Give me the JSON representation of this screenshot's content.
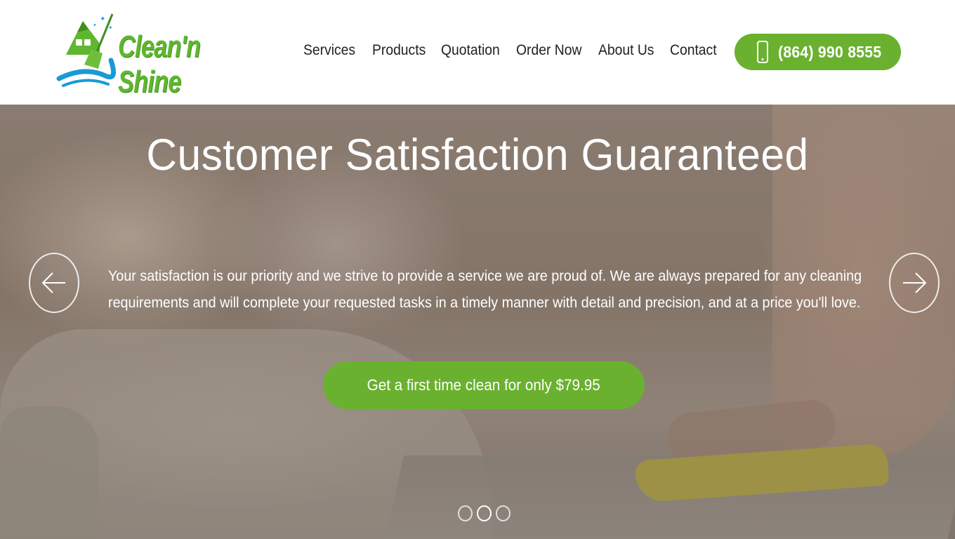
{
  "brand": {
    "name": "Clean'n Shine",
    "logo_colors": {
      "primary": "#5fb62f",
      "wave": "#1a9ad6"
    }
  },
  "nav": {
    "items": [
      {
        "label": "Services"
      },
      {
        "label": "Products"
      },
      {
        "label": "Quotation"
      },
      {
        "label": "Order Now"
      },
      {
        "label": "About Us"
      },
      {
        "label": "Contact"
      }
    ]
  },
  "header": {
    "phone_icon": "mobile-phone-icon",
    "phone_label": "(864) 990 8555"
  },
  "hero": {
    "title": "Customer Satisfaction Guaranteed",
    "text_line1": "Your satisfaction is our priority and we strive to provide a service we are proud of. We are always prepared for any cleaning",
    "text_line2": "requirements and will complete your requested tasks in a timely manner with detail and precision, and at a price you'll love.",
    "cta_label": "Get a first time clean for only $79.95",
    "prev_icon": "arrow-left-icon",
    "next_icon": "arrow-right-icon",
    "slides_total": 3,
    "active_slide": 2
  },
  "colors": {
    "accent": "#6ab12f",
    "nav_text": "#222222"
  }
}
